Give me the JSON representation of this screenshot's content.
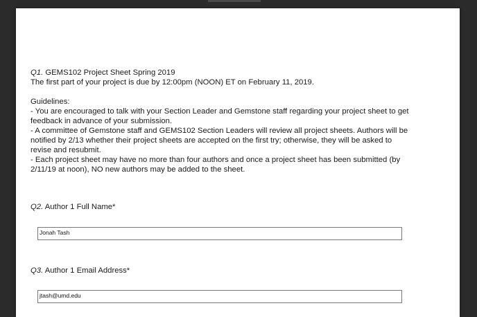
{
  "q1": {
    "number": "Q1.",
    "title": "GEMS102 Project Sheet Spring 2019",
    "due": "The first part of your project is due by 12:00pm (NOON) ET on February 11, 2019.",
    "guidelines_heading": "Guidelines:",
    "guideline_1_line1": "- You are encouraged to talk with your Section Leader and Gemstone staff regarding your project sheet to get",
    "guideline_1_line2": "feedback in advance of your submission.",
    "guideline_2_line1": "- A committee of Gemstone staff and GEMS102 Section Leaders will review all project sheets. Authors will be",
    "guideline_2_line2": "notified by 2/13 whether their project sheets are accepted on the first try; otherwise, they will be asked to",
    "guideline_2_line3": "revise and resubmit.",
    "guideline_3_line1": "- Each project sheet may have no more than four authors and once a project sheet has been submitted (by",
    "guideline_3_line2": "2/11/19 at noon), NO new authors may be added to the sheet."
  },
  "q2": {
    "number": "Q2.",
    "label": "Author 1 Full Name*",
    "value": "Jonah Tash"
  },
  "q3": {
    "number": "Q3.",
    "label": "Author 1 Email Address*",
    "value": "jtash@umd.edu"
  }
}
